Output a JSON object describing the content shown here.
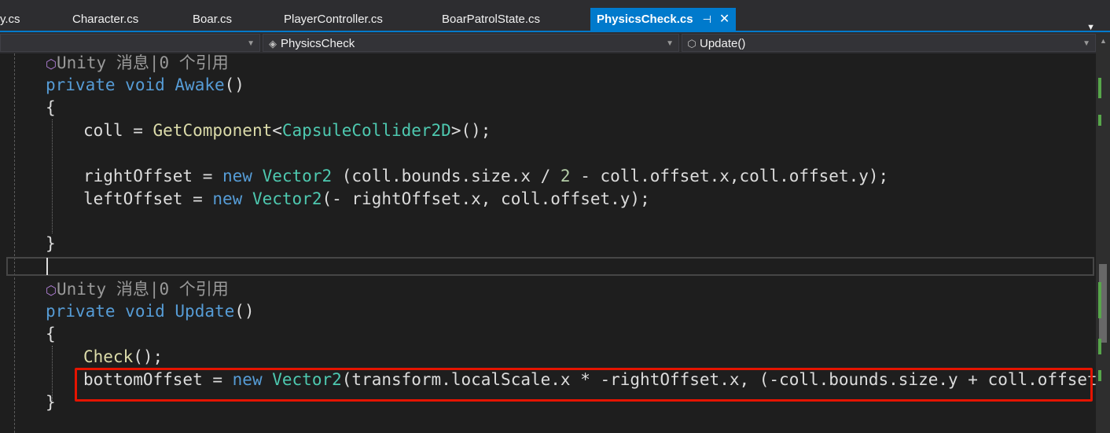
{
  "tabs": [
    {
      "label": "y.cs"
    },
    {
      "label": "Character.cs"
    },
    {
      "label": "Boar.cs"
    },
    {
      "label": "PlayerController.cs"
    },
    {
      "label": "BoarPatrolState.cs"
    },
    {
      "label": "PhysicsCheck.cs",
      "active": true,
      "pin": "⊣",
      "close": "✕"
    }
  ],
  "tab_overflow": "▼",
  "navbar": {
    "project_dropdown": "",
    "class_dropdown": "PhysicsCheck",
    "member_dropdown": "Update()",
    "class_icon": "class-icon",
    "member_icon": "method-icon"
  },
  "code": {
    "lens1": "Unity 消息|0 个引用",
    "l_awake_sig": {
      "kw1": "private",
      "kw2": "void",
      "name": "Awake",
      "tail": "()"
    },
    "brace_open": "{",
    "brace_close": "}",
    "l_coll": {
      "a": "coll = ",
      "fn": "GetComponent",
      "b": "<",
      "ty": "CapsuleCollider2D",
      "c": ">();"
    },
    "l_right": {
      "a": "rightOffset = ",
      "kw": "new",
      "ty": "Vector2",
      "b": " (coll.bounds.size.x / ",
      "num": "2",
      "c": " - coll.offset.x,coll.offset.y);"
    },
    "l_left": {
      "a": "leftOffset = ",
      "kw": "new",
      "ty": "Vector2",
      "b": "(- rightOffset.x, coll.offset.y);"
    },
    "lens2": "Unity 消息|0 个引用",
    "l_update_sig": {
      "kw1": "private",
      "kw2": "void",
      "name": "Update",
      "tail": "()"
    },
    "l_check": {
      "fn": "Check",
      "a": "();"
    },
    "l_bottom": {
      "a": "bottomOffset = ",
      "kw": "new",
      "ty": "Vector2",
      "b": "(transform.localScale.x * -rightOffset.x, (-coll.bounds.size.y + coll.offset.y));"
    }
  },
  "colors": {
    "keyword": "#569cd6",
    "type": "#4ec9b0",
    "method": "#dcdcaa",
    "highlight_box": "#e51400",
    "tab_active": "#007acc"
  }
}
